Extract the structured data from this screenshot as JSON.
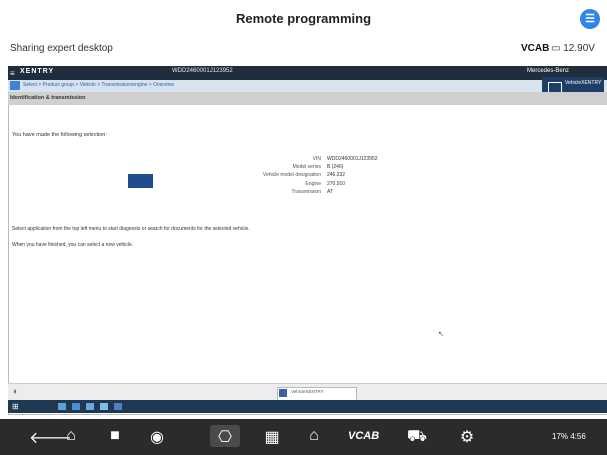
{
  "app": {
    "title": "Remote programming",
    "icon": "app-menu-icon"
  },
  "share": {
    "status_text": "Sharing expert desktop",
    "vci_label": "VCAB",
    "battery": "12.90V",
    "battery_icon": "battery-icon"
  },
  "remote": {
    "brand": "XENTRY",
    "vin": "WDD2460001J123952",
    "vin_sub": "",
    "header_mid": "",
    "header_right": "Mercedes-Benz",
    "breadcrumb": "Select > Product group > Vehicle > Transmission/engine > Overview",
    "mini_window_title": "VehicleXENTRY",
    "section_title": "Identification & transmission",
    "selection_heading": "You have made the following selection:",
    "fields": [
      {
        "key": "VIN",
        "value": "WDD2460001J123952"
      },
      {
        "key": "Model series",
        "value": "B (246)"
      },
      {
        "key": "Vehicle model designation",
        "value": "246.232"
      },
      {
        "key": "Engine",
        "value": "270.910"
      },
      {
        "key": "Transmission",
        "value": "AT"
      }
    ],
    "instruction_1": "Select application from the top left menu to start diagnosis or search for documents for the selected vehicle.",
    "instruction_2": "When you have finished, you can select a new vehicle.",
    "task_thumbnail": "VehicleXENTRY",
    "tray_text": "",
    "taskbar_icon_colors": [
      "#5fa0d8",
      "#4c8fd1",
      "#6aa7dd",
      "#7cc0e8",
      "#4b7fbf"
    ]
  },
  "navbar": {
    "items": [
      "back-icon",
      "home-icon",
      "square-icon",
      "chrome-icon",
      "camera-icon",
      "gallery-icon",
      "house-icon",
      "vci-icon",
      "car-icon",
      "settings-icon"
    ],
    "vci_text": "VCAB",
    "status": "17% 4:56"
  },
  "colors": {
    "accent": "#2f86e8",
    "window_header": "#1f2d3d",
    "breadcrumb_bg": "#d9e3ee",
    "navbar_bg": "#2b2b2b"
  }
}
